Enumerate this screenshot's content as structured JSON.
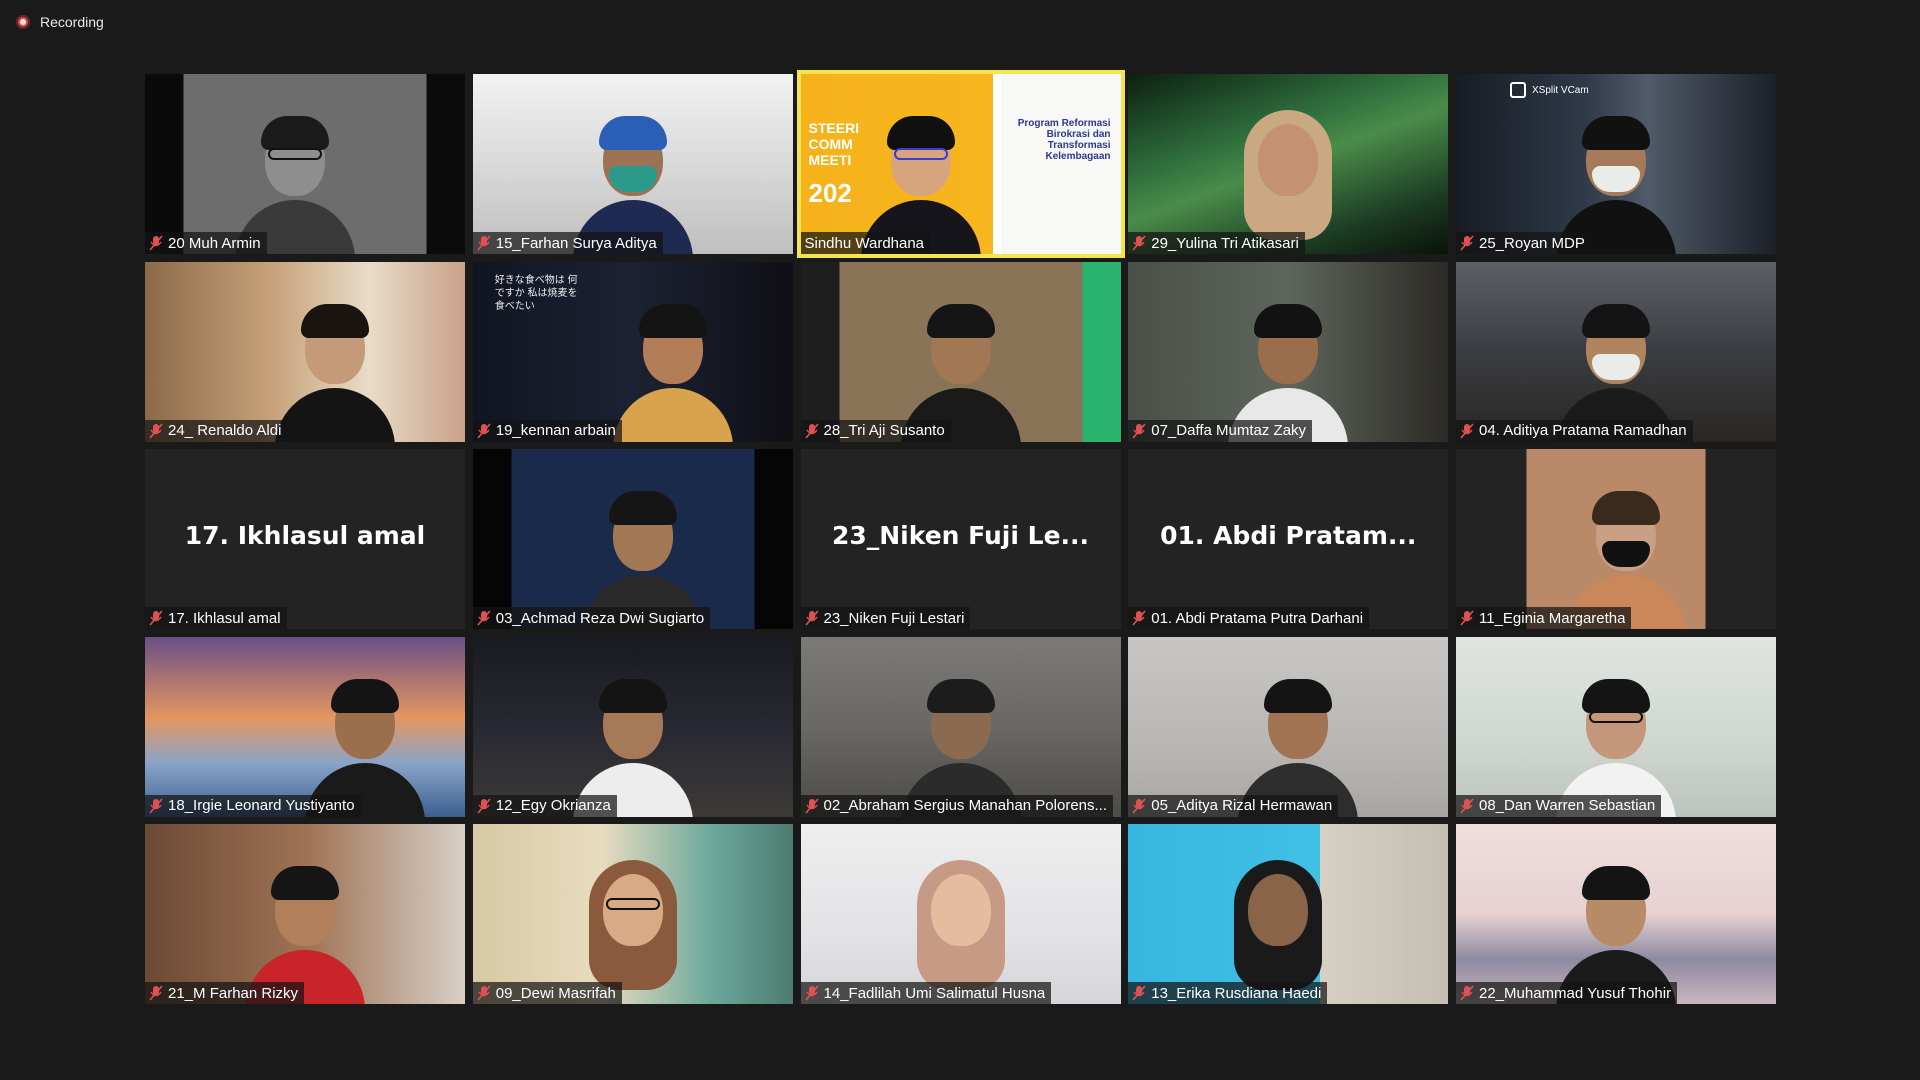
{
  "recording": {
    "label": "Recording"
  },
  "tiles": [
    {
      "name": "20 Muh Armin"
    },
    {
      "name": "15_Farhan Surya Aditya"
    },
    {
      "name": "Sindhu Wardhana",
      "active": true
    },
    {
      "name": "29_Yulina Tri Atikasari"
    },
    {
      "name": "25_Royan MDP",
      "overlay": "XSplit VCam"
    },
    {
      "name": "24_ Renaldo Aldi"
    },
    {
      "name": "19_kennan arbain"
    },
    {
      "name": "28_Tri Aji Susanto"
    },
    {
      "name": "07_Daffa Mumtaz Zaky"
    },
    {
      "name": "04. Aditiya Pratama Ramadhan"
    },
    {
      "name": "17. Ikhlasul amal",
      "display": "17. Ikhlasul amal"
    },
    {
      "name": "03_Achmad Reza Dwi Sugiarto"
    },
    {
      "name": "23_Niken Fuji Lestari",
      "display": "23_Niken Fuji Le..."
    },
    {
      "name": "01. Abdi Pratama Putra Darhani",
      "display": "01. Abdi Pratam..."
    },
    {
      "name": "11_Eginia Margaretha"
    },
    {
      "name": "18_Irgie Leonard Yustiyanto"
    },
    {
      "name": "12_Egy Okrianza"
    },
    {
      "name": "02_Abraham Sergius Manahan Polorens..."
    },
    {
      "name": "05_Aditya Rizal Hermawan"
    },
    {
      "name": "08_Dan Warren Sebastian"
    },
    {
      "name": "21_M Farhan Rizky"
    },
    {
      "name": "09_Dewi Masrifah"
    },
    {
      "name": "14_Fadlilah Umi Salimatul Husna"
    },
    {
      "name": "13_Erika Rusdiana Haedi"
    },
    {
      "name": "22_Muhammad Yusuf Thohir"
    }
  ],
  "slide": {
    "line1": "STEERI",
    "line2": "COMM",
    "line3": "MEETI",
    "year": "202",
    "program": "Program Reformasi Birokrasi dan Transformasi Kelembagaan"
  },
  "kennan_overlay": "好きな食べ物は 何ですか 私は焼麦を食べたい",
  "colors": {
    "active_border": "#f4e44d",
    "muted_mic": "#e05252",
    "background": "#1a1a1a"
  }
}
